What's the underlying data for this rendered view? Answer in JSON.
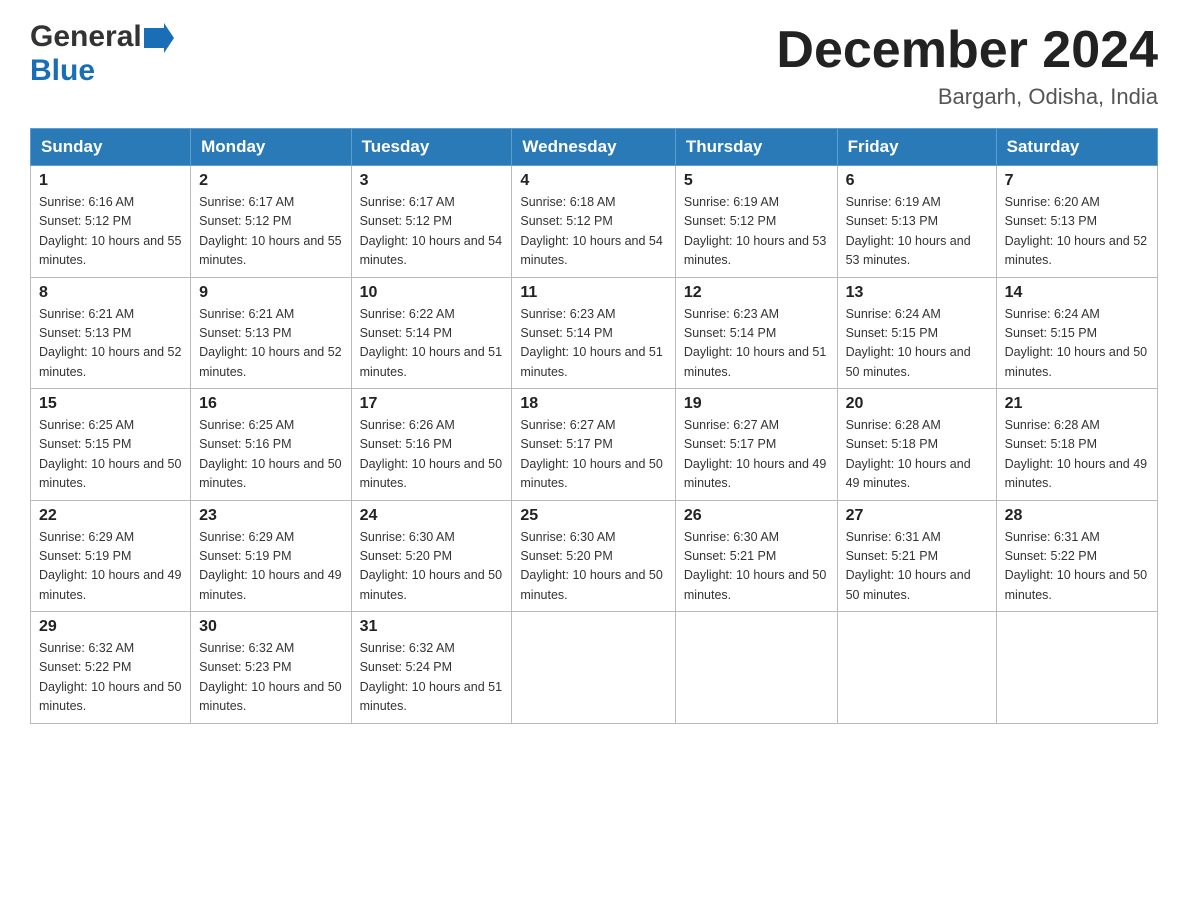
{
  "header": {
    "logo_general": "General",
    "logo_blue": "Blue",
    "title": "December 2024",
    "location": "Bargarh, Odisha, India"
  },
  "calendar": {
    "days_of_week": [
      "Sunday",
      "Monday",
      "Tuesday",
      "Wednesday",
      "Thursday",
      "Friday",
      "Saturday"
    ],
    "weeks": [
      [
        {
          "day": "1",
          "sunrise": "6:16 AM",
          "sunset": "5:12 PM",
          "daylight": "10 hours and 55 minutes."
        },
        {
          "day": "2",
          "sunrise": "6:17 AM",
          "sunset": "5:12 PM",
          "daylight": "10 hours and 55 minutes."
        },
        {
          "day": "3",
          "sunrise": "6:17 AM",
          "sunset": "5:12 PM",
          "daylight": "10 hours and 54 minutes."
        },
        {
          "day": "4",
          "sunrise": "6:18 AM",
          "sunset": "5:12 PM",
          "daylight": "10 hours and 54 minutes."
        },
        {
          "day": "5",
          "sunrise": "6:19 AM",
          "sunset": "5:12 PM",
          "daylight": "10 hours and 53 minutes."
        },
        {
          "day": "6",
          "sunrise": "6:19 AM",
          "sunset": "5:13 PM",
          "daylight": "10 hours and 53 minutes."
        },
        {
          "day": "7",
          "sunrise": "6:20 AM",
          "sunset": "5:13 PM",
          "daylight": "10 hours and 52 minutes."
        }
      ],
      [
        {
          "day": "8",
          "sunrise": "6:21 AM",
          "sunset": "5:13 PM",
          "daylight": "10 hours and 52 minutes."
        },
        {
          "day": "9",
          "sunrise": "6:21 AM",
          "sunset": "5:13 PM",
          "daylight": "10 hours and 52 minutes."
        },
        {
          "day": "10",
          "sunrise": "6:22 AM",
          "sunset": "5:14 PM",
          "daylight": "10 hours and 51 minutes."
        },
        {
          "day": "11",
          "sunrise": "6:23 AM",
          "sunset": "5:14 PM",
          "daylight": "10 hours and 51 minutes."
        },
        {
          "day": "12",
          "sunrise": "6:23 AM",
          "sunset": "5:14 PM",
          "daylight": "10 hours and 51 minutes."
        },
        {
          "day": "13",
          "sunrise": "6:24 AM",
          "sunset": "5:15 PM",
          "daylight": "10 hours and 50 minutes."
        },
        {
          "day": "14",
          "sunrise": "6:24 AM",
          "sunset": "5:15 PM",
          "daylight": "10 hours and 50 minutes."
        }
      ],
      [
        {
          "day": "15",
          "sunrise": "6:25 AM",
          "sunset": "5:15 PM",
          "daylight": "10 hours and 50 minutes."
        },
        {
          "day": "16",
          "sunrise": "6:25 AM",
          "sunset": "5:16 PM",
          "daylight": "10 hours and 50 minutes."
        },
        {
          "day": "17",
          "sunrise": "6:26 AM",
          "sunset": "5:16 PM",
          "daylight": "10 hours and 50 minutes."
        },
        {
          "day": "18",
          "sunrise": "6:27 AM",
          "sunset": "5:17 PM",
          "daylight": "10 hours and 50 minutes."
        },
        {
          "day": "19",
          "sunrise": "6:27 AM",
          "sunset": "5:17 PM",
          "daylight": "10 hours and 49 minutes."
        },
        {
          "day": "20",
          "sunrise": "6:28 AM",
          "sunset": "5:18 PM",
          "daylight": "10 hours and 49 minutes."
        },
        {
          "day": "21",
          "sunrise": "6:28 AM",
          "sunset": "5:18 PM",
          "daylight": "10 hours and 49 minutes."
        }
      ],
      [
        {
          "day": "22",
          "sunrise": "6:29 AM",
          "sunset": "5:19 PM",
          "daylight": "10 hours and 49 minutes."
        },
        {
          "day": "23",
          "sunrise": "6:29 AM",
          "sunset": "5:19 PM",
          "daylight": "10 hours and 49 minutes."
        },
        {
          "day": "24",
          "sunrise": "6:30 AM",
          "sunset": "5:20 PM",
          "daylight": "10 hours and 50 minutes."
        },
        {
          "day": "25",
          "sunrise": "6:30 AM",
          "sunset": "5:20 PM",
          "daylight": "10 hours and 50 minutes."
        },
        {
          "day": "26",
          "sunrise": "6:30 AM",
          "sunset": "5:21 PM",
          "daylight": "10 hours and 50 minutes."
        },
        {
          "day": "27",
          "sunrise": "6:31 AM",
          "sunset": "5:21 PM",
          "daylight": "10 hours and 50 minutes."
        },
        {
          "day": "28",
          "sunrise": "6:31 AM",
          "sunset": "5:22 PM",
          "daylight": "10 hours and 50 minutes."
        }
      ],
      [
        {
          "day": "29",
          "sunrise": "6:32 AM",
          "sunset": "5:22 PM",
          "daylight": "10 hours and 50 minutes."
        },
        {
          "day": "30",
          "sunrise": "6:32 AM",
          "sunset": "5:23 PM",
          "daylight": "10 hours and 50 minutes."
        },
        {
          "day": "31",
          "sunrise": "6:32 AM",
          "sunset": "5:24 PM",
          "daylight": "10 hours and 51 minutes."
        },
        null,
        null,
        null,
        null
      ]
    ],
    "sunrise_label": "Sunrise:",
    "sunset_label": "Sunset:",
    "daylight_label": "Daylight:"
  }
}
